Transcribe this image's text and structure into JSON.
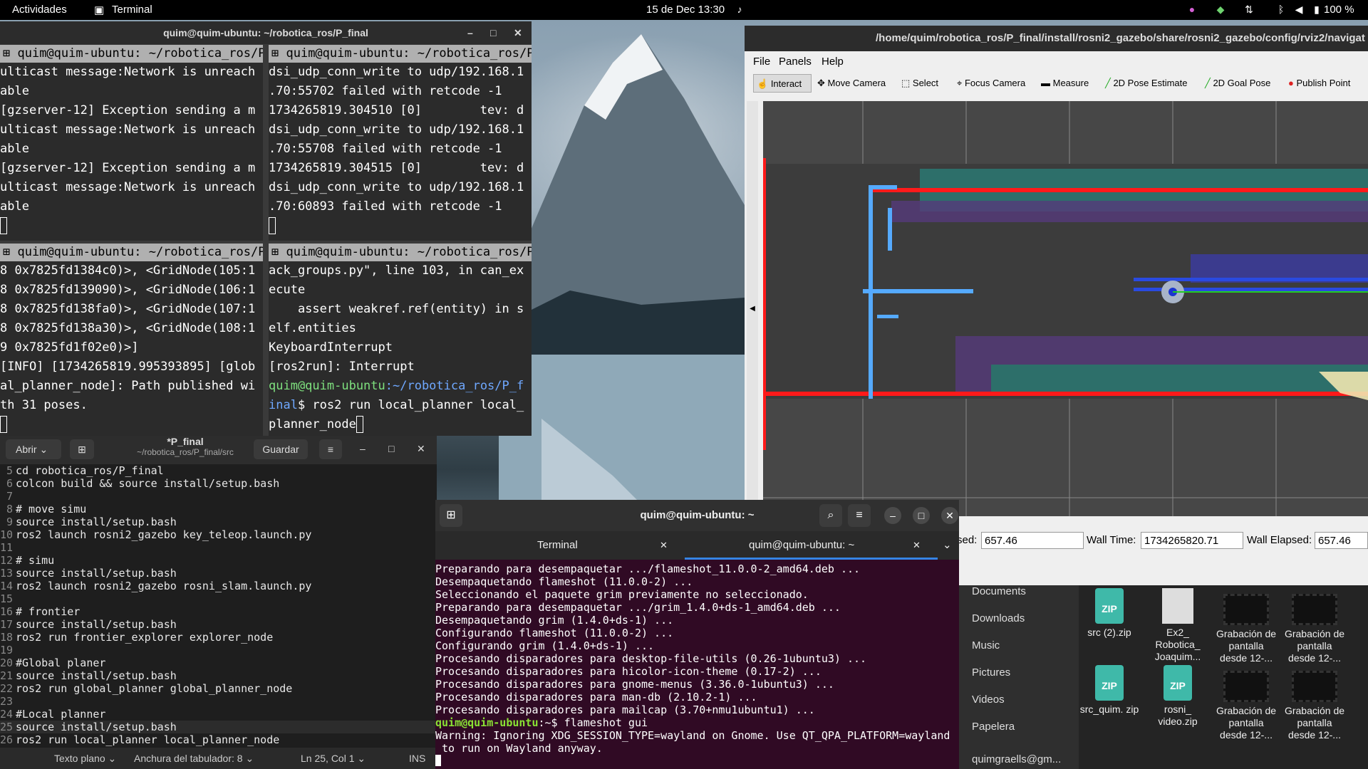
{
  "topbar": {
    "activities": "Actividades",
    "app_name": "Terminal",
    "datetime": "15 de Dec  13:30",
    "battery": "100 %"
  },
  "terminator": {
    "title": "quim@quim-ubuntu: ~/robotica_ros/P_final",
    "panes": [
      {
        "header": "quim@quim-ubuntu: ~/robotica_ros/P",
        "lines": [
          "ulticast message:Network is unreach",
          "able",
          "[gzserver-12] Exception sending a m",
          "ulticast message:Network is unreach",
          "able",
          "[gzserver-12] Exception sending a m",
          "ulticast message:Network is unreach",
          "able"
        ]
      },
      {
        "header": "quim@quim-ubuntu: ~/robotica_ros/P",
        "lines": [
          "dsi_udp_conn_write to udp/192.168.1",
          ".70:55702 failed with retcode -1",
          "1734265819.304510 [0]        tev: d",
          "dsi_udp_conn_write to udp/192.168.1",
          ".70:55708 failed with retcode -1",
          "1734265819.304515 [0]        tev: d",
          "dsi_udp_conn_write to udp/192.168.1",
          ".70:60893 failed with retcode -1"
        ]
      },
      {
        "header": "quim@quim-ubuntu: ~/robotica_ros/P",
        "lines": [
          "8 0x7825fd1384c0)>, <GridNode(105:1",
          "8 0x7825fd139090)>, <GridNode(106:1",
          "8 0x7825fd138fa0)>, <GridNode(107:1",
          "8 0x7825fd138a30)>, <GridNode(108:1",
          "9 0x7825fd1f02e0)>]",
          "[INFO] [1734265819.995393895] [glob",
          "al_planner_node]: Path published wi",
          "th 31 poses."
        ]
      },
      {
        "header": "quim@quim-ubuntu: ~/robotica_ros/P",
        "lines": [
          "ack_groups.py\", line 103, in can_ex",
          "ecute",
          "    assert weakref.ref(entity) in s",
          "elf.entities",
          "KeyboardInterrupt",
          "[ros2run]: Interrupt"
        ],
        "prompt_user": "quim@quim-ubuntu",
        "prompt_path_a": ":~/robotica_ros/P_f",
        "prompt_path_b": "inal",
        "prompt_cmd_a": "$ ros2 run local_planner local_",
        "prompt_cmd_b": "planner_node"
      }
    ]
  },
  "gedit": {
    "open_label": "Abrir",
    "file_name": "*P_final",
    "file_path": "~/robotica_ros/P_final/src",
    "save_label": "Guardar",
    "lines": [
      {
        "n": "5",
        "t": "cd robotica_ros/P_final"
      },
      {
        "n": "6",
        "t": "colcon build && source install/setup.bash"
      },
      {
        "n": "7",
        "t": ""
      },
      {
        "n": "8",
        "t": "# move simu"
      },
      {
        "n": "9",
        "t": "source install/setup.bash"
      },
      {
        "n": "10",
        "t": "ros2 launch rosni2_gazebo key_teleop.launch.py"
      },
      {
        "n": "11",
        "t": ""
      },
      {
        "n": "12",
        "t": "# simu"
      },
      {
        "n": "13",
        "t": "source install/setup.bash"
      },
      {
        "n": "14",
        "t": "ros2 launch rosni2_gazebo rosni_slam.launch.py"
      },
      {
        "n": "15",
        "t": ""
      },
      {
        "n": "16",
        "t": "# frontier"
      },
      {
        "n": "17",
        "t": "source install/setup.bash"
      },
      {
        "n": "18",
        "t": "ros2 run frontier_explorer explorer_node"
      },
      {
        "n": "19",
        "t": ""
      },
      {
        "n": "20",
        "t": "#Global planer"
      },
      {
        "n": "21",
        "t": "source install/setup.bash"
      },
      {
        "n": "22",
        "t": "ros2 run global_planner global_planner_node"
      },
      {
        "n": "23",
        "t": ""
      },
      {
        "n": "24",
        "t": "#Local planner"
      },
      {
        "n": "25",
        "t": "source install/setup.bash"
      },
      {
        "n": "26",
        "t": "ros2 run local_planner local_planner_node"
      }
    ],
    "status_lang": "Texto plano",
    "status_tab": "Anchura del tabulador: 8",
    "status_pos": "Ln 25, Col 1",
    "status_mode": "INS"
  },
  "rviz": {
    "title": "/home/quim/robotica_ros/P_final/install/rosni2_gazebo/share/rosni2_gazebo/config/rviz2/navigat",
    "menu": [
      "File",
      "Panels",
      "Help"
    ],
    "tools": [
      "Interact",
      "Move Camera",
      "Select",
      "Focus Camera",
      "Measure",
      "2D Pose Estimate",
      "2D Goal Pose",
      "Publish Point"
    ],
    "time": {
      "elapsed_label": "sed:",
      "elapsed_value": "657.46",
      "wall_time_label": "Wall Time:",
      "wall_time_value": "1734265820.71",
      "wall_elapsed_label": "Wall Elapsed:",
      "wall_elapsed_value": "657.46"
    }
  },
  "files": {
    "sidebar": [
      "Documents",
      "Downloads",
      "Music",
      "Pictures",
      "Videos",
      "Papelera",
      "quimgraells@gm..."
    ],
    "items": [
      {
        "name": "src (2).zip",
        "kind": "zip"
      },
      {
        "name": "Ex2_ Robotica_ Joaquim...",
        "kind": "doc"
      },
      {
        "name": "Grabación de pantalla desde 12-...",
        "kind": "video"
      },
      {
        "name": "Grabación de pantalla desde 12-...",
        "kind": "video"
      },
      {
        "name": "src_quim. zip",
        "kind": "zip"
      },
      {
        "name": "rosni_ video.zip",
        "kind": "zip"
      },
      {
        "name": "Grabación de pantalla desde 12-...",
        "kind": "video"
      },
      {
        "name": "Grabación de pantalla desde 12-...",
        "kind": "video"
      }
    ]
  },
  "gterm": {
    "title": "quim@quim-ubuntu: ~",
    "tab1": "Terminal",
    "tab2": "quim@quim-ubuntu: ~",
    "lines": [
      "Preparando para desempaquetar .../flameshot_11.0.0-2_amd64.deb ...",
      "Desempaquetando flameshot (11.0.0-2) ...",
      "Seleccionando el paquete grim previamente no seleccionado.",
      "Preparando para desempaquetar .../grim_1.4.0+ds-1_amd64.deb ...",
      "Desempaquetando grim (1.4.0+ds-1) ...",
      "Configurando flameshot (11.0.0-2) ...",
      "Configurando grim (1.4.0+ds-1) ...",
      "Procesando disparadores para desktop-file-utils (0.26-1ubuntu3) ...",
      "Procesando disparadores para hicolor-icon-theme (0.17-2) ...",
      "Procesando disparadores para gnome-menus (3.36.0-1ubuntu3) ...",
      "Procesando disparadores para man-db (2.10.2-1) ...",
      "Procesando disparadores para mailcap (3.70+nmu1ubuntu1) ..."
    ],
    "prompt_user": "quim@quim-ubuntu",
    "prompt_rest": ":~$ flameshot gui",
    "warn1": "Warning: Ignoring XDG_SESSION_TYPE=wayland on Gnome. Use QT_QPA_PLATFORM=wayland",
    "warn2": " to run on Wayland anyway."
  },
  "colors": {
    "terminal_bg": "#2b2b2b",
    "gnome_terminal_bg": "#300a24",
    "prompt_green": "#7ee07e",
    "prompt_blue": "#6fa8ff",
    "map_wall": "#ff1a1a",
    "map_path": "#55aaff"
  }
}
